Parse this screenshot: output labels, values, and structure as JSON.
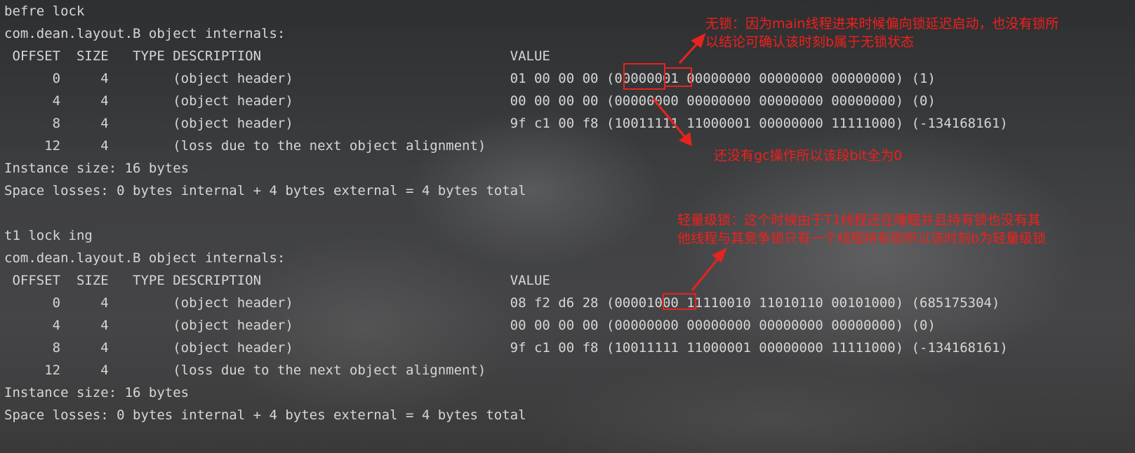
{
  "console": {
    "lines": [
      "befre lock",
      "com.dean.layout.B object internals:",
      " OFFSET  SIZE   TYPE DESCRIPTION                               VALUE",
      "      0     4        (object header)                           01 00 00 00 (00000001 00000000 00000000 00000000) (1)",
      "      4     4        (object header)                           00 00 00 00 (00000000 00000000 00000000 00000000) (0)",
      "      8     4        (object header)                           9f c1 00 f8 (10011111 11000001 00000000 11111000) (-134168161)",
      "     12     4        (loss due to the next object alignment)",
      "Instance size: 16 bytes",
      "Space losses: 0 bytes internal + 4 bytes external = 4 bytes total",
      "",
      "t1 lock ing",
      "com.dean.layout.B object internals:",
      " OFFSET  SIZE   TYPE DESCRIPTION                               VALUE",
      "      0     4        (object header)                           08 f2 d6 28 (00001000 11110010 11010110 00101000) (685175304)",
      "      4     4        (object header)                           00 00 00 00 (00000000 00000000 00000000 00000000) (0)",
      "      8     4        (object header)                           9f c1 00 f8 (10011111 11000001 00000000 11111000) (-134168161)",
      "     12     4        (loss due to the next object alignment)",
      "Instance size: 16 bytes",
      "Space losses: 0 bytes internal + 4 bytes external = 4 bytes total"
    ]
  },
  "annotations": {
    "lock_free": {
      "line1": "无锁：因为main线程进来时候偏向锁延迟启动，也没有锁所",
      "line2": "以结论可确认该时刻b属于无锁状态"
    },
    "gc": {
      "text": "还没有gc操作所以该段bit全为0"
    },
    "lightweight": {
      "line1": "轻量级锁：这个时候由于T1线程还在睡眠并且持有锁也没有其",
      "line2": "他线程与其竞争锁只有一个线程持有锁所以该时刻b为轻量级锁"
    }
  },
  "colors": {
    "console_text": "#d6d6d6",
    "annotation_red": "#f0201b",
    "box_red": "#e8231d",
    "background": "#3b3c3e"
  }
}
